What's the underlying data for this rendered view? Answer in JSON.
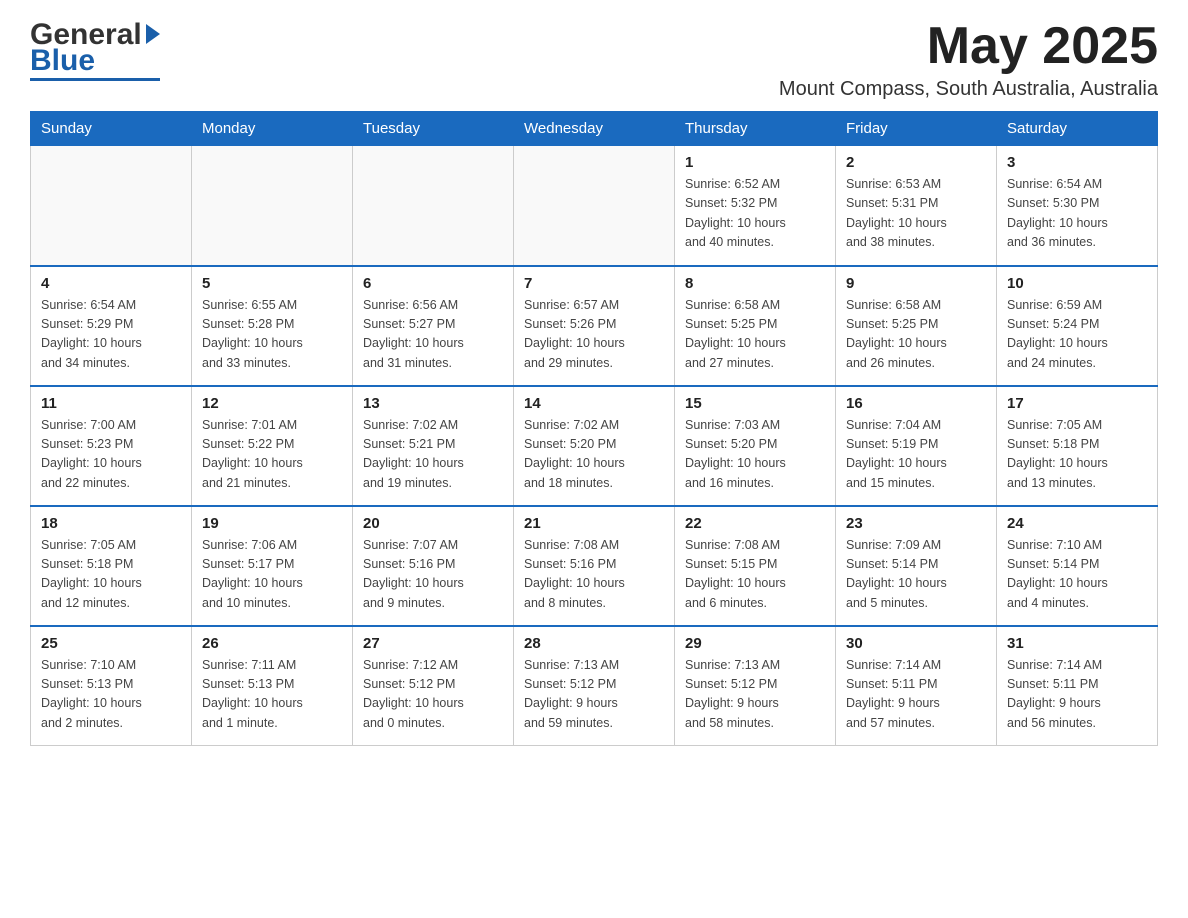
{
  "header": {
    "month_year": "May 2025",
    "location": "Mount Compass, South Australia, Australia"
  },
  "logo": {
    "general": "General",
    "blue": "Blue"
  },
  "weekdays": [
    "Sunday",
    "Monday",
    "Tuesday",
    "Wednesday",
    "Thursday",
    "Friday",
    "Saturday"
  ],
  "weeks": [
    [
      {
        "day": "",
        "info": ""
      },
      {
        "day": "",
        "info": ""
      },
      {
        "day": "",
        "info": ""
      },
      {
        "day": "",
        "info": ""
      },
      {
        "day": "1",
        "info": "Sunrise: 6:52 AM\nSunset: 5:32 PM\nDaylight: 10 hours\nand 40 minutes."
      },
      {
        "day": "2",
        "info": "Sunrise: 6:53 AM\nSunset: 5:31 PM\nDaylight: 10 hours\nand 38 minutes."
      },
      {
        "day": "3",
        "info": "Sunrise: 6:54 AM\nSunset: 5:30 PM\nDaylight: 10 hours\nand 36 minutes."
      }
    ],
    [
      {
        "day": "4",
        "info": "Sunrise: 6:54 AM\nSunset: 5:29 PM\nDaylight: 10 hours\nand 34 minutes."
      },
      {
        "day": "5",
        "info": "Sunrise: 6:55 AM\nSunset: 5:28 PM\nDaylight: 10 hours\nand 33 minutes."
      },
      {
        "day": "6",
        "info": "Sunrise: 6:56 AM\nSunset: 5:27 PM\nDaylight: 10 hours\nand 31 minutes."
      },
      {
        "day": "7",
        "info": "Sunrise: 6:57 AM\nSunset: 5:26 PM\nDaylight: 10 hours\nand 29 minutes."
      },
      {
        "day": "8",
        "info": "Sunrise: 6:58 AM\nSunset: 5:25 PM\nDaylight: 10 hours\nand 27 minutes."
      },
      {
        "day": "9",
        "info": "Sunrise: 6:58 AM\nSunset: 5:25 PM\nDaylight: 10 hours\nand 26 minutes."
      },
      {
        "day": "10",
        "info": "Sunrise: 6:59 AM\nSunset: 5:24 PM\nDaylight: 10 hours\nand 24 minutes."
      }
    ],
    [
      {
        "day": "11",
        "info": "Sunrise: 7:00 AM\nSunset: 5:23 PM\nDaylight: 10 hours\nand 22 minutes."
      },
      {
        "day": "12",
        "info": "Sunrise: 7:01 AM\nSunset: 5:22 PM\nDaylight: 10 hours\nand 21 minutes."
      },
      {
        "day": "13",
        "info": "Sunrise: 7:02 AM\nSunset: 5:21 PM\nDaylight: 10 hours\nand 19 minutes."
      },
      {
        "day": "14",
        "info": "Sunrise: 7:02 AM\nSunset: 5:20 PM\nDaylight: 10 hours\nand 18 minutes."
      },
      {
        "day": "15",
        "info": "Sunrise: 7:03 AM\nSunset: 5:20 PM\nDaylight: 10 hours\nand 16 minutes."
      },
      {
        "day": "16",
        "info": "Sunrise: 7:04 AM\nSunset: 5:19 PM\nDaylight: 10 hours\nand 15 minutes."
      },
      {
        "day": "17",
        "info": "Sunrise: 7:05 AM\nSunset: 5:18 PM\nDaylight: 10 hours\nand 13 minutes."
      }
    ],
    [
      {
        "day": "18",
        "info": "Sunrise: 7:05 AM\nSunset: 5:18 PM\nDaylight: 10 hours\nand 12 minutes."
      },
      {
        "day": "19",
        "info": "Sunrise: 7:06 AM\nSunset: 5:17 PM\nDaylight: 10 hours\nand 10 minutes."
      },
      {
        "day": "20",
        "info": "Sunrise: 7:07 AM\nSunset: 5:16 PM\nDaylight: 10 hours\nand 9 minutes."
      },
      {
        "day": "21",
        "info": "Sunrise: 7:08 AM\nSunset: 5:16 PM\nDaylight: 10 hours\nand 8 minutes."
      },
      {
        "day": "22",
        "info": "Sunrise: 7:08 AM\nSunset: 5:15 PM\nDaylight: 10 hours\nand 6 minutes."
      },
      {
        "day": "23",
        "info": "Sunrise: 7:09 AM\nSunset: 5:14 PM\nDaylight: 10 hours\nand 5 minutes."
      },
      {
        "day": "24",
        "info": "Sunrise: 7:10 AM\nSunset: 5:14 PM\nDaylight: 10 hours\nand 4 minutes."
      }
    ],
    [
      {
        "day": "25",
        "info": "Sunrise: 7:10 AM\nSunset: 5:13 PM\nDaylight: 10 hours\nand 2 minutes."
      },
      {
        "day": "26",
        "info": "Sunrise: 7:11 AM\nSunset: 5:13 PM\nDaylight: 10 hours\nand 1 minute."
      },
      {
        "day": "27",
        "info": "Sunrise: 7:12 AM\nSunset: 5:12 PM\nDaylight: 10 hours\nand 0 minutes."
      },
      {
        "day": "28",
        "info": "Sunrise: 7:13 AM\nSunset: 5:12 PM\nDaylight: 9 hours\nand 59 minutes."
      },
      {
        "day": "29",
        "info": "Sunrise: 7:13 AM\nSunset: 5:12 PM\nDaylight: 9 hours\nand 58 minutes."
      },
      {
        "day": "30",
        "info": "Sunrise: 7:14 AM\nSunset: 5:11 PM\nDaylight: 9 hours\nand 57 minutes."
      },
      {
        "day": "31",
        "info": "Sunrise: 7:14 AM\nSunset: 5:11 PM\nDaylight: 9 hours\nand 56 minutes."
      }
    ]
  ]
}
